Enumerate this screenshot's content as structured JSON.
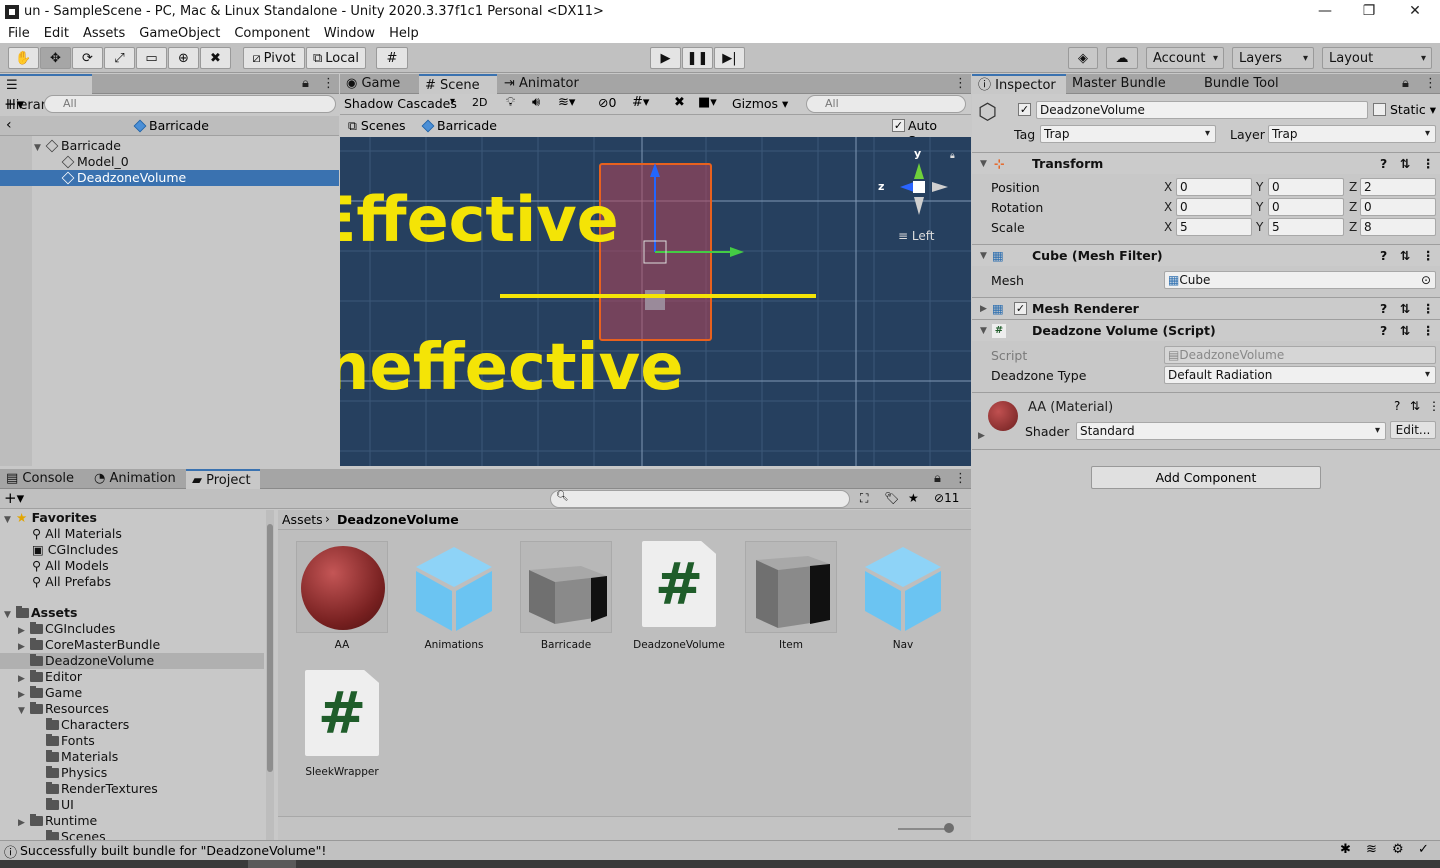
{
  "window": {
    "title": "un - SampleScene - PC, Mac & Linux Standalone - Unity 2020.3.37f1c1 Personal <DX11>",
    "min": "—",
    "max": "❐",
    "close": "✕"
  },
  "menu": [
    "File",
    "Edit",
    "Assets",
    "GameObject",
    "Component",
    "Window",
    "Help"
  ],
  "toolbar": {
    "pivot": "Pivot",
    "local": "Local",
    "account": "Account",
    "layers": "Layers",
    "layout": "Layout"
  },
  "hierarchy": {
    "tab": "Hierarchy",
    "search_placeholder": "All",
    "breadcrumb": "Barricade",
    "items": [
      {
        "label": "Barricade"
      },
      {
        "label": "Model_0"
      },
      {
        "label": "DeadzoneVolume"
      }
    ]
  },
  "scene": {
    "tabs": [
      "Game",
      "Scene",
      "Animator"
    ],
    "shading": "Shadow Cascades",
    "mode2d": "2D",
    "hidden_count": "0",
    "gizmos": "Gizmos",
    "search_placeholder": "All",
    "crumb_scenes": "Scenes",
    "crumb_prefab": "Barricade",
    "autosave": "Auto Save",
    "annotation_effective": "Effective",
    "annotation_ineffective": "Ineffective",
    "orient_label": "Left",
    "axis_y": "y",
    "axis_z": "z"
  },
  "inspector": {
    "tabs": [
      "Inspector",
      "Master Bundle Tool",
      "Bundle Tool"
    ],
    "object_name": "DeadzoneVolume",
    "static_label": "Static",
    "tag_label": "Tag",
    "tag_value": "Trap",
    "layer_label": "Layer",
    "layer_value": "Trap",
    "transform": {
      "title": "Transform",
      "rows": [
        {
          "label": "Position",
          "x": "0",
          "y": "0",
          "z": "2"
        },
        {
          "label": "Rotation",
          "x": "0",
          "y": "0",
          "z": "0"
        },
        {
          "label": "Scale",
          "x": "5",
          "y": "5",
          "z": "8"
        }
      ]
    },
    "meshfilter": {
      "title": "Cube (Mesh Filter)",
      "mesh_label": "Mesh",
      "mesh_value": "Cube"
    },
    "meshrenderer": {
      "title": "Mesh Renderer"
    },
    "script_comp": {
      "title": "Deadzone Volume (Script)",
      "script_label": "Script",
      "script_value": "DeadzoneVolume",
      "type_label": "Deadzone Type",
      "type_value": "Default Radiation"
    },
    "material": {
      "title": "AA (Material)",
      "shader_label": "Shader",
      "shader_value": "Standard",
      "edit": "Edit..."
    },
    "add_component": "Add Component",
    "axis": {
      "x": "X",
      "y": "Y",
      "z": "Z"
    }
  },
  "project": {
    "tabs": [
      "Console",
      "Animation",
      "Project"
    ],
    "hidden_count": "11",
    "breadcrumb_root": "Assets",
    "breadcrumb_current": "DeadzoneVolume",
    "favorites_title": "Favorites",
    "favorites": [
      "All Materials",
      "CGIncludes",
      "All Models",
      "All Prefabs"
    ],
    "assets_title": "Assets",
    "folders": [
      {
        "label": "CGIncludes"
      },
      {
        "label": "CoreMasterBundle"
      },
      {
        "label": "DeadzoneVolume"
      },
      {
        "label": "Editor"
      },
      {
        "label": "Game"
      },
      {
        "label": "Resources"
      },
      {
        "label": "Characters"
      },
      {
        "label": "Fonts"
      },
      {
        "label": "Materials"
      },
      {
        "label": "Physics"
      },
      {
        "label": "RenderTextures"
      },
      {
        "label": "UI"
      },
      {
        "label": "Runtime"
      },
      {
        "label": "Scenes"
      }
    ],
    "assets": [
      {
        "name": "AA",
        "icon": "material-sphere-icon"
      },
      {
        "name": "Animations",
        "icon": "blue-cube-icon"
      },
      {
        "name": "Barricade",
        "icon": "gray-cube-icon"
      },
      {
        "name": "DeadzoneVolume",
        "icon": "script-icon"
      },
      {
        "name": "Item",
        "icon": "gray-cube-icon"
      },
      {
        "name": "Nav",
        "icon": "blue-cube-icon"
      },
      {
        "name": "SleekWrapper",
        "icon": "script-icon"
      }
    ]
  },
  "status": {
    "message": "Successfully built bundle for \"DeadzoneVolume\"!"
  },
  "colors": {
    "selection": "#3a72b0",
    "scene_bg": "#26405f",
    "annotation": "#f4e406",
    "gizmo_orange": "#e8611e"
  }
}
